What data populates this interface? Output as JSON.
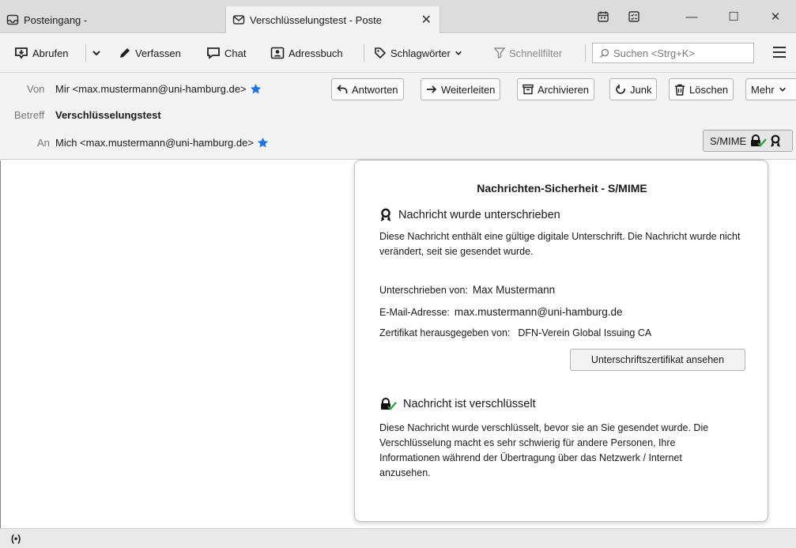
{
  "tabs": [
    {
      "label": "Posteingang -"
    },
    {
      "label": "Verschlüsselungstest - Poste"
    }
  ],
  "toolbar": {
    "get_label": "Abrufen",
    "compose_label": "Verfassen",
    "chat_label": "Chat",
    "addressbook_label": "Adressbuch",
    "tags_label": "Schlagwörter",
    "quickfilter_label": "Schnellfilter",
    "search_placeholder": "Suchen <Strg+K>"
  },
  "header": {
    "from_label": "Von",
    "from_value": "Mir <max.mustermann@uni-hamburg.de>",
    "subject_label": "Betreff",
    "subject_value": "Verschlüsselungstest",
    "to_label": "An",
    "to_value": "Mich <max.mustermann@uni-hamburg.de>",
    "buttons": {
      "reply": "Antworten",
      "forward": "Weiterleiten",
      "archive": "Archivieren",
      "junk": "Junk",
      "delete": "Löschen",
      "more": "Mehr"
    },
    "smime_label": "S/MIME"
  },
  "security_panel": {
    "title": "Nachrichten-Sicherheit - S/MIME",
    "signed_heading": "Nachricht wurde unterschrieben",
    "signed_text": "Diese Nachricht enthält eine gültige digitale Unterschrift. Die Nachricht wurde nicht verändert, seit sie gesendet wurde.",
    "signed_by_label": "Unterschrieben von:",
    "signed_by_value": "Max Mustermann",
    "email_label": "E-Mail-Adresse:",
    "email_value": "max.mustermann@uni-hamburg.de",
    "issuer_label": "Zertifikat herausgegeben von:",
    "issuer_value": "DFN-Verein Global Issuing CA",
    "view_cert_button": "Unterschriftszertifikat ansehen",
    "encrypted_heading": "Nachricht ist verschlüsselt",
    "encrypted_text": "Diese Nachricht wurde verschlüsselt, bevor sie an Sie gesendet wurde. Die Verschlüsselung macht es sehr schwierig für andere Personen, Ihre Informationen während der Übertragung über das Netzwerk / Internet anzusehen."
  },
  "statusbar": {
    "icon": "(•)"
  },
  "colors": {
    "star": "#1a73e8",
    "check": "#2e9d3a"
  }
}
